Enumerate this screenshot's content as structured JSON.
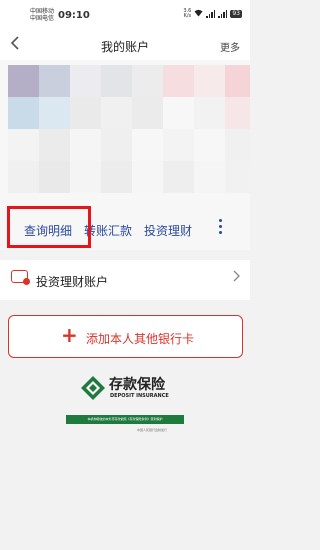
{
  "status_bar": {
    "carrier_1": "中国移动",
    "carrier_2": "中国电信",
    "time": "09:10",
    "network": "3.6",
    "network_unit": "K/s",
    "battery": "93"
  },
  "header": {
    "title": "我的账户",
    "more_label": "更多"
  },
  "card": {
    "actions": [
      "查询明细",
      "转账汇款",
      "投资理财"
    ]
  },
  "investment": {
    "label": "投资理财账户"
  },
  "add_card": {
    "label": "添加本人其他银行卡"
  },
  "deposit_insurance": {
    "name_cn": "存款保险",
    "name_en": "DEPOSIT INSURANCE",
    "band_text": "本机构吸收的本外币存款依照《存款保险条例》受到保护",
    "footnote": "中国人民银行监制发行"
  },
  "colors": {
    "brand_red": "#d9342b",
    "link_blue": "#2b4a9e",
    "highlight": "#e8141b",
    "insurance_green": "#1f7a3e"
  }
}
